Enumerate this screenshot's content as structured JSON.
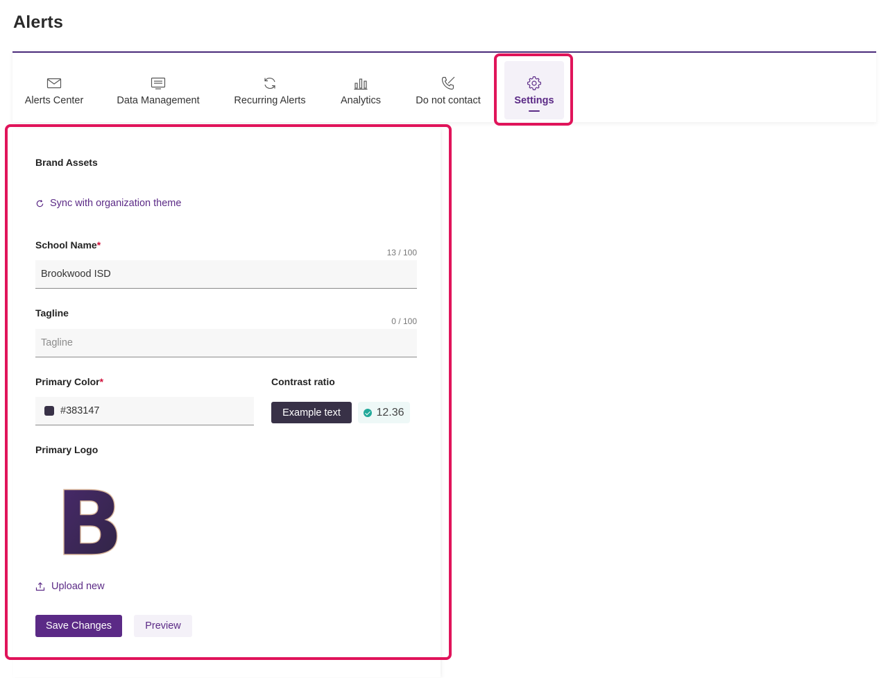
{
  "page": {
    "title": "Alerts"
  },
  "colors": {
    "brand": "#5b2a86",
    "primary_color": "#383147",
    "highlight": "#e0145a",
    "contrast_ok": "#22a99a"
  },
  "tabs": [
    {
      "label": "Alerts Center",
      "icon": "envelope-icon",
      "active": false
    },
    {
      "label": "Data Management",
      "icon": "monitor-icon",
      "active": false
    },
    {
      "label": "Recurring Alerts",
      "icon": "refresh-icon",
      "active": false
    },
    {
      "label": "Analytics",
      "icon": "bar-chart-icon",
      "active": false
    },
    {
      "label": "Do not contact",
      "icon": "phone-off-icon",
      "active": false
    },
    {
      "label": "Settings",
      "icon": "gear-icon",
      "active": true
    }
  ],
  "brand_assets": {
    "section_title": "Brand Assets",
    "sync_label": "Sync with organization theme",
    "school_name": {
      "label": "School Name",
      "required_mark": "*",
      "counter": "13 / 100",
      "value": "Brookwood ISD"
    },
    "tagline": {
      "label": "Tagline",
      "counter": "0 / 100",
      "value": "",
      "placeholder": "Tagline"
    },
    "primary_color": {
      "label": "Primary Color",
      "required_mark": "*",
      "value": "#383147"
    },
    "contrast": {
      "label": "Contrast ratio",
      "example_text": "Example text",
      "ratio": "12.36"
    },
    "primary_logo": {
      "label": "Primary Logo",
      "logo_letter": "B"
    },
    "upload_label": "Upload new"
  },
  "actions": {
    "save_label": "Save Changes",
    "preview_label": "Preview"
  }
}
